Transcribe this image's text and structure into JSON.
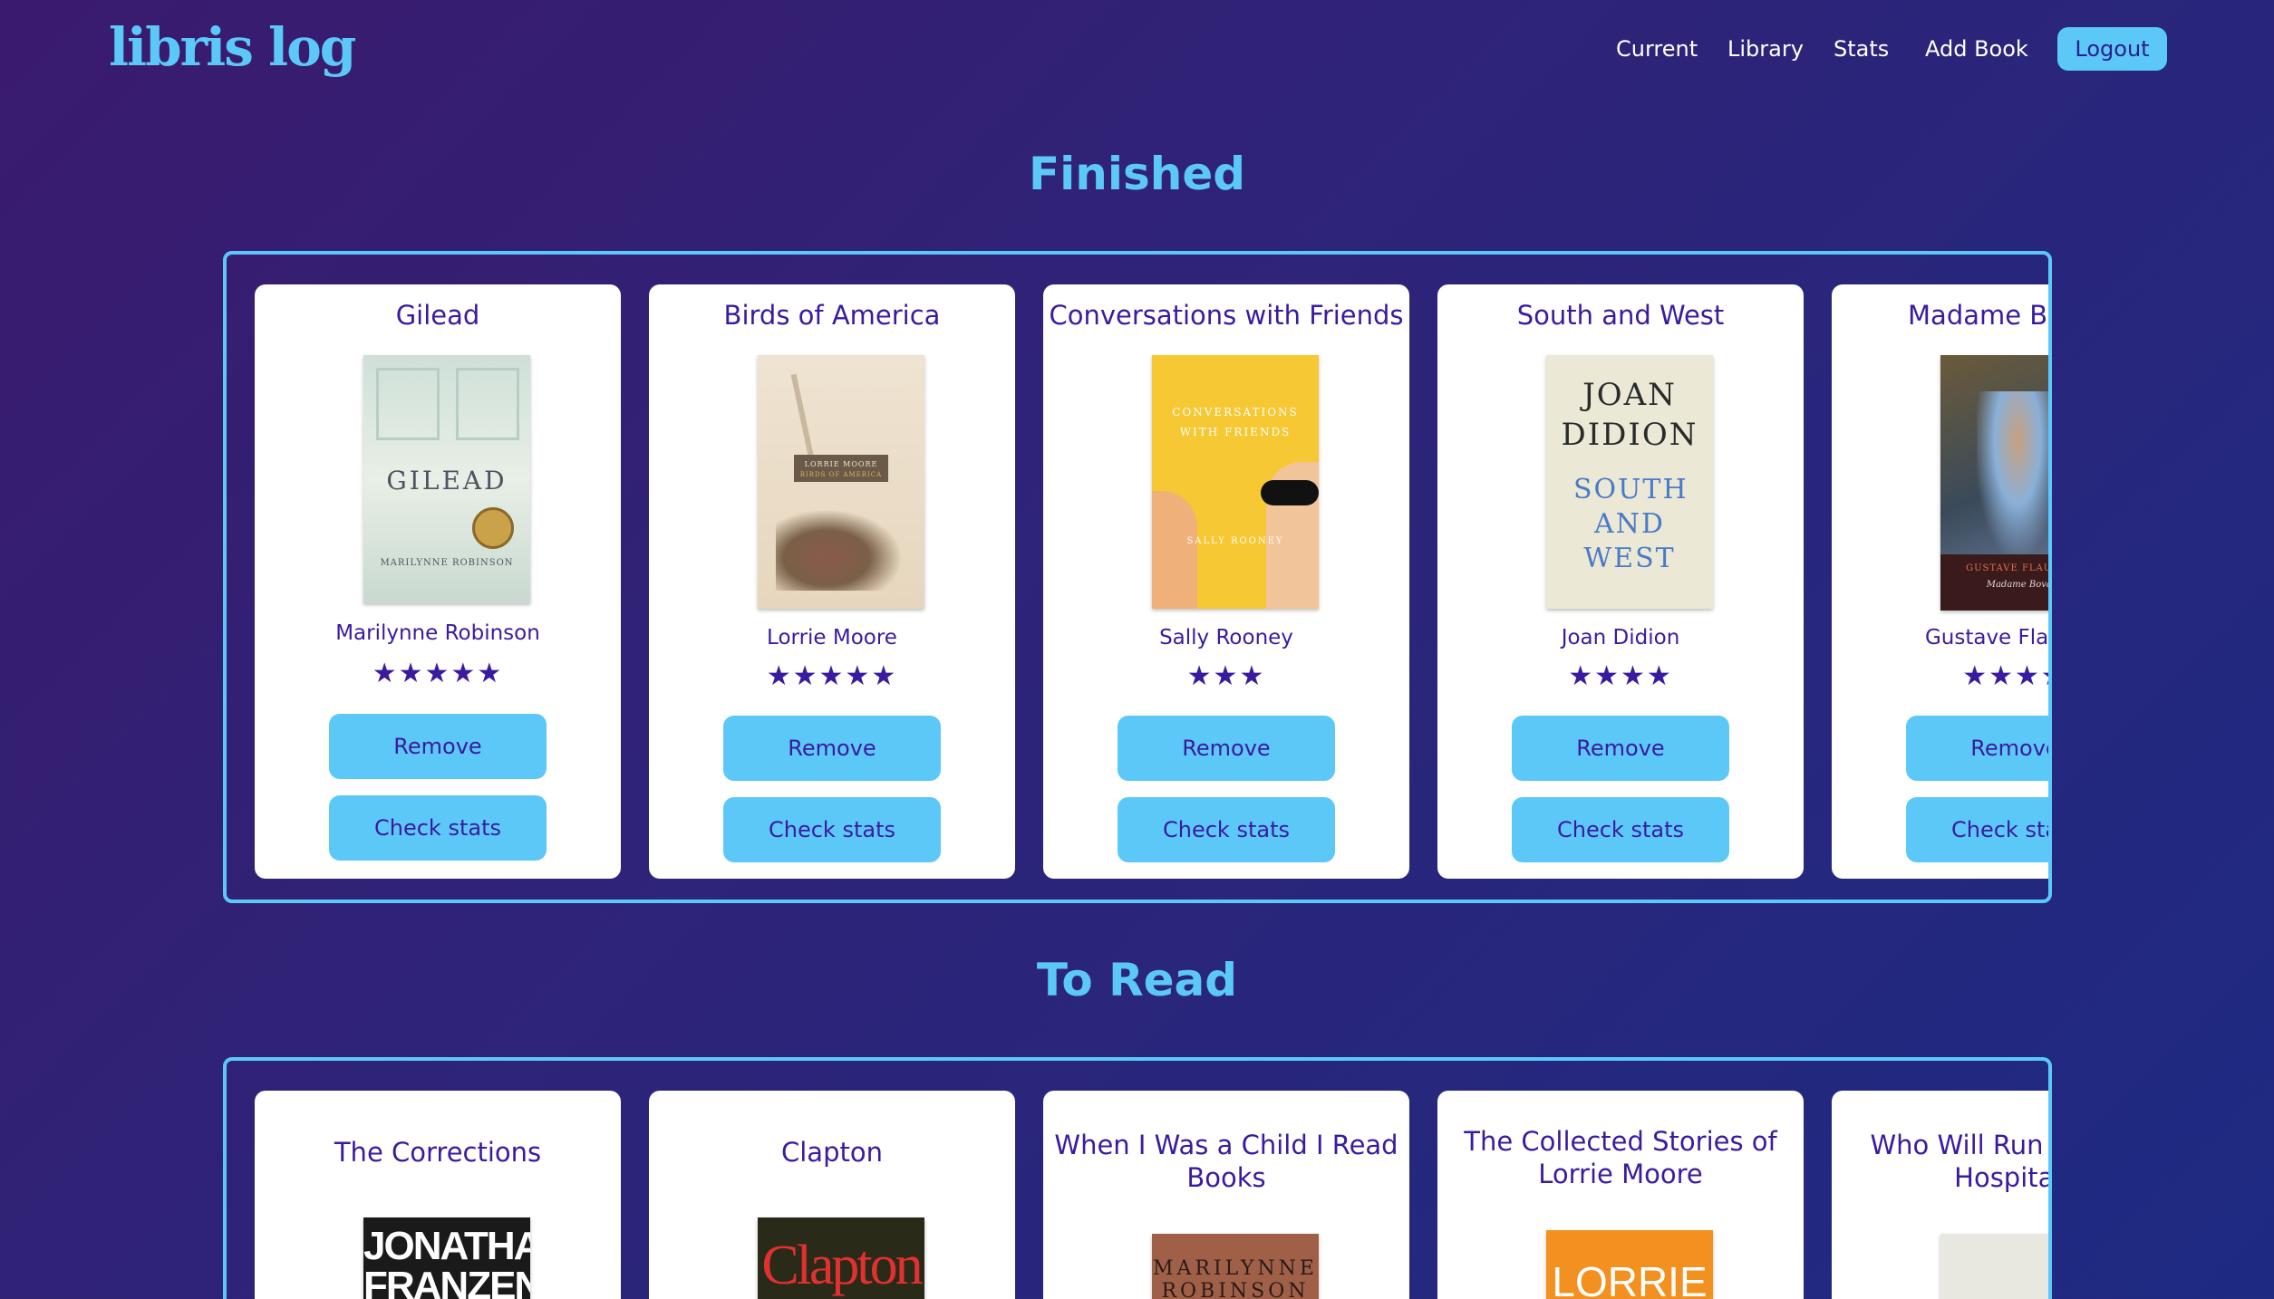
{
  "app": {
    "logo": "libris log"
  },
  "nav": {
    "links": [
      "Current",
      "Library",
      "Stats",
      "Add Book"
    ],
    "logout_label": "Logout"
  },
  "finished": {
    "title": "Finished",
    "books": [
      {
        "title": "Gilead",
        "author": "Marilynne Robinson",
        "rating": 5,
        "stars": "★★★★★",
        "remove_label": "Remove",
        "stats_label": "Check stats",
        "cover_text": "GILEAD",
        "cover_sub": "MARILYNNE ROBINSON"
      },
      {
        "title": "Birds of America",
        "author": "Lorrie Moore",
        "rating": 5,
        "stars": "★★★★★",
        "remove_label": "Remove",
        "stats_label": "Check stats",
        "cover_text": "LORRIE MOORE",
        "cover_sub": "BIRDS OF AMERICA"
      },
      {
        "title": "Conversations with Friends",
        "author": "Sally Rooney",
        "rating": 3,
        "stars": "★★★",
        "remove_label": "Remove",
        "stats_label": "Check stats",
        "cover_text": "CONVERSATIONS WITH FRIENDS",
        "cover_sub": "SALLY ROONEY"
      },
      {
        "title": "South and West",
        "author": "Joan Didion",
        "rating": 4,
        "stars": "★★★★",
        "remove_label": "Remove",
        "stats_label": "Check stats",
        "cover_text": "JOAN DIDION",
        "cover_sub": "SOUTH AND WEST"
      },
      {
        "title": "Madame Bovary",
        "author": "Gustave Flaubert",
        "rating": 4,
        "stars": "★★★★",
        "remove_label": "Remove",
        "stats_label": "Check stats",
        "cover_text": "GUSTAVE FLAUBERT",
        "cover_sub": "Madame Bovary"
      }
    ]
  },
  "to_read": {
    "title": "To Read",
    "books": [
      {
        "title": "The Corrections",
        "cover_text": "JONATHAN FRANZEN"
      },
      {
        "title": "Clapton",
        "cover_text": "Clapton"
      },
      {
        "title": "When I Was a Child I Read Books",
        "cover_text": "MARILYNNE ROBINSON"
      },
      {
        "title": "The Collected Stories of Lorrie Moore",
        "cover_text": "LORRIE"
      },
      {
        "title": "Who Will Run the Frog Hospital?",
        "cover_text": ""
      }
    ]
  },
  "colors": {
    "accent": "#5cc8f8",
    "text_primary": "#3a1ba0",
    "background": "#2f2377"
  }
}
